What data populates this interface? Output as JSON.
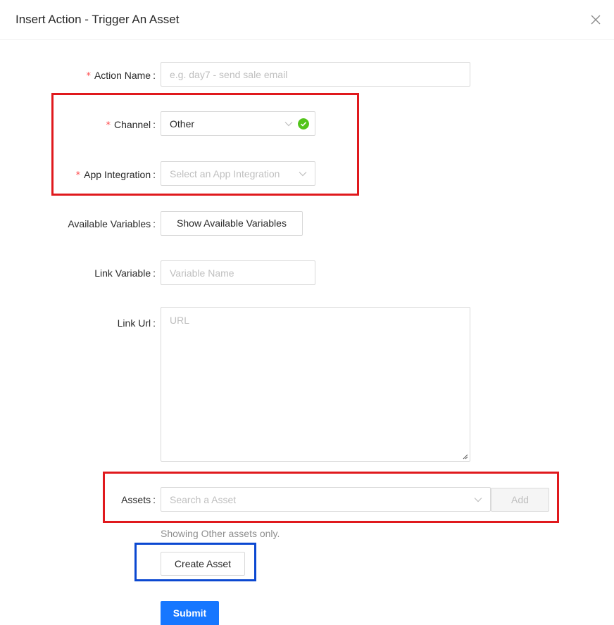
{
  "modal": {
    "title": "Insert Action - Trigger An Asset"
  },
  "form": {
    "action_name": {
      "label": "Action Name",
      "placeholder": "e.g. day7 - send sale email",
      "required": true
    },
    "channel": {
      "label": "Channel",
      "value": "Other",
      "required": true,
      "validated": true
    },
    "app_integration": {
      "label": "App Integration",
      "placeholder": "Select an App Integration",
      "required": true
    },
    "available_variables": {
      "label": "Available Variables",
      "button_label": "Show Available Variables"
    },
    "link_variable": {
      "label": "Link Variable",
      "placeholder": "Variable Name"
    },
    "link_url": {
      "label": "Link Url",
      "placeholder": "URL"
    },
    "assets": {
      "label": "Assets",
      "placeholder": "Search a Asset",
      "add_label": "Add",
      "help_text": "Showing Other assets only."
    },
    "create_asset_label": "Create Asset",
    "submit_label": "Submit",
    "required_mark": "*",
    "colon": ":"
  },
  "icons": {
    "close": "close-icon",
    "chevron": "chevron-down-icon",
    "check": "check-circle-icon"
  },
  "colors": {
    "primary": "#1677ff",
    "success": "#52c41a",
    "required": "#ff4d4f",
    "highlight_red": "#e0191d",
    "highlight_blue": "#0b48d1"
  }
}
